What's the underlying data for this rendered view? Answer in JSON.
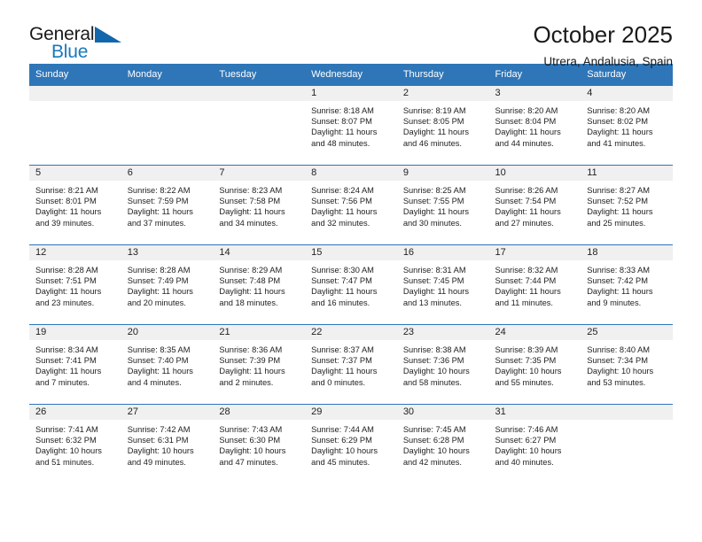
{
  "logo": {
    "general": "General",
    "blue": "Blue",
    "triangle_color": "#1166ac"
  },
  "header": {
    "title": "October 2025",
    "subtitle": "Utrera, Andalusia, Spain"
  },
  "theme": {
    "header_blue": "#2e76b8",
    "daynum_band": "#f0f0f0"
  },
  "weekday_headers": [
    "Sunday",
    "Monday",
    "Tuesday",
    "Wednesday",
    "Thursday",
    "Friday",
    "Saturday"
  ],
  "weeks": [
    [
      {
        "day": "",
        "sunrise": "",
        "sunset": "",
        "daylight_1": "",
        "daylight_2": "",
        "empty": true
      },
      {
        "day": "",
        "sunrise": "",
        "sunset": "",
        "daylight_1": "",
        "daylight_2": "",
        "empty": true
      },
      {
        "day": "",
        "sunrise": "",
        "sunset": "",
        "daylight_1": "",
        "daylight_2": "",
        "empty": true
      },
      {
        "day": "1",
        "sunrise": "Sunrise: 8:18 AM",
        "sunset": "Sunset: 8:07 PM",
        "daylight_1": "Daylight: 11 hours",
        "daylight_2": "and 48 minutes."
      },
      {
        "day": "2",
        "sunrise": "Sunrise: 8:19 AM",
        "sunset": "Sunset: 8:05 PM",
        "daylight_1": "Daylight: 11 hours",
        "daylight_2": "and 46 minutes."
      },
      {
        "day": "3",
        "sunrise": "Sunrise: 8:20 AM",
        "sunset": "Sunset: 8:04 PM",
        "daylight_1": "Daylight: 11 hours",
        "daylight_2": "and 44 minutes."
      },
      {
        "day": "4",
        "sunrise": "Sunrise: 8:20 AM",
        "sunset": "Sunset: 8:02 PM",
        "daylight_1": "Daylight: 11 hours",
        "daylight_2": "and 41 minutes."
      }
    ],
    [
      {
        "day": "5",
        "sunrise": "Sunrise: 8:21 AM",
        "sunset": "Sunset: 8:01 PM",
        "daylight_1": "Daylight: 11 hours",
        "daylight_2": "and 39 minutes."
      },
      {
        "day": "6",
        "sunrise": "Sunrise: 8:22 AM",
        "sunset": "Sunset: 7:59 PM",
        "daylight_1": "Daylight: 11 hours",
        "daylight_2": "and 37 minutes."
      },
      {
        "day": "7",
        "sunrise": "Sunrise: 8:23 AM",
        "sunset": "Sunset: 7:58 PM",
        "daylight_1": "Daylight: 11 hours",
        "daylight_2": "and 34 minutes."
      },
      {
        "day": "8",
        "sunrise": "Sunrise: 8:24 AM",
        "sunset": "Sunset: 7:56 PM",
        "daylight_1": "Daylight: 11 hours",
        "daylight_2": "and 32 minutes."
      },
      {
        "day": "9",
        "sunrise": "Sunrise: 8:25 AM",
        "sunset": "Sunset: 7:55 PM",
        "daylight_1": "Daylight: 11 hours",
        "daylight_2": "and 30 minutes."
      },
      {
        "day": "10",
        "sunrise": "Sunrise: 8:26 AM",
        "sunset": "Sunset: 7:54 PM",
        "daylight_1": "Daylight: 11 hours",
        "daylight_2": "and 27 minutes."
      },
      {
        "day": "11",
        "sunrise": "Sunrise: 8:27 AM",
        "sunset": "Sunset: 7:52 PM",
        "daylight_1": "Daylight: 11 hours",
        "daylight_2": "and 25 minutes."
      }
    ],
    [
      {
        "day": "12",
        "sunrise": "Sunrise: 8:28 AM",
        "sunset": "Sunset: 7:51 PM",
        "daylight_1": "Daylight: 11 hours",
        "daylight_2": "and 23 minutes."
      },
      {
        "day": "13",
        "sunrise": "Sunrise: 8:28 AM",
        "sunset": "Sunset: 7:49 PM",
        "daylight_1": "Daylight: 11 hours",
        "daylight_2": "and 20 minutes."
      },
      {
        "day": "14",
        "sunrise": "Sunrise: 8:29 AM",
        "sunset": "Sunset: 7:48 PM",
        "daylight_1": "Daylight: 11 hours",
        "daylight_2": "and 18 minutes."
      },
      {
        "day": "15",
        "sunrise": "Sunrise: 8:30 AM",
        "sunset": "Sunset: 7:47 PM",
        "daylight_1": "Daylight: 11 hours",
        "daylight_2": "and 16 minutes."
      },
      {
        "day": "16",
        "sunrise": "Sunrise: 8:31 AM",
        "sunset": "Sunset: 7:45 PM",
        "daylight_1": "Daylight: 11 hours",
        "daylight_2": "and 13 minutes."
      },
      {
        "day": "17",
        "sunrise": "Sunrise: 8:32 AM",
        "sunset": "Sunset: 7:44 PM",
        "daylight_1": "Daylight: 11 hours",
        "daylight_2": "and 11 minutes."
      },
      {
        "day": "18",
        "sunrise": "Sunrise: 8:33 AM",
        "sunset": "Sunset: 7:42 PM",
        "daylight_1": "Daylight: 11 hours",
        "daylight_2": "and 9 minutes."
      }
    ],
    [
      {
        "day": "19",
        "sunrise": "Sunrise: 8:34 AM",
        "sunset": "Sunset: 7:41 PM",
        "daylight_1": "Daylight: 11 hours",
        "daylight_2": "and 7 minutes."
      },
      {
        "day": "20",
        "sunrise": "Sunrise: 8:35 AM",
        "sunset": "Sunset: 7:40 PM",
        "daylight_1": "Daylight: 11 hours",
        "daylight_2": "and 4 minutes."
      },
      {
        "day": "21",
        "sunrise": "Sunrise: 8:36 AM",
        "sunset": "Sunset: 7:39 PM",
        "daylight_1": "Daylight: 11 hours",
        "daylight_2": "and 2 minutes."
      },
      {
        "day": "22",
        "sunrise": "Sunrise: 8:37 AM",
        "sunset": "Sunset: 7:37 PM",
        "daylight_1": "Daylight: 11 hours",
        "daylight_2": "and 0 minutes."
      },
      {
        "day": "23",
        "sunrise": "Sunrise: 8:38 AM",
        "sunset": "Sunset: 7:36 PM",
        "daylight_1": "Daylight: 10 hours",
        "daylight_2": "and 58 minutes."
      },
      {
        "day": "24",
        "sunrise": "Sunrise: 8:39 AM",
        "sunset": "Sunset: 7:35 PM",
        "daylight_1": "Daylight: 10 hours",
        "daylight_2": "and 55 minutes."
      },
      {
        "day": "25",
        "sunrise": "Sunrise: 8:40 AM",
        "sunset": "Sunset: 7:34 PM",
        "daylight_1": "Daylight: 10 hours",
        "daylight_2": "and 53 minutes."
      }
    ],
    [
      {
        "day": "26",
        "sunrise": "Sunrise: 7:41 AM",
        "sunset": "Sunset: 6:32 PM",
        "daylight_1": "Daylight: 10 hours",
        "daylight_2": "and 51 minutes."
      },
      {
        "day": "27",
        "sunrise": "Sunrise: 7:42 AM",
        "sunset": "Sunset: 6:31 PM",
        "daylight_1": "Daylight: 10 hours",
        "daylight_2": "and 49 minutes."
      },
      {
        "day": "28",
        "sunrise": "Sunrise: 7:43 AM",
        "sunset": "Sunset: 6:30 PM",
        "daylight_1": "Daylight: 10 hours",
        "daylight_2": "and 47 minutes."
      },
      {
        "day": "29",
        "sunrise": "Sunrise: 7:44 AM",
        "sunset": "Sunset: 6:29 PM",
        "daylight_1": "Daylight: 10 hours",
        "daylight_2": "and 45 minutes."
      },
      {
        "day": "30",
        "sunrise": "Sunrise: 7:45 AM",
        "sunset": "Sunset: 6:28 PM",
        "daylight_1": "Daylight: 10 hours",
        "daylight_2": "and 42 minutes."
      },
      {
        "day": "31",
        "sunrise": "Sunrise: 7:46 AM",
        "sunset": "Sunset: 6:27 PM",
        "daylight_1": "Daylight: 10 hours",
        "daylight_2": "and 40 minutes."
      },
      {
        "day": "",
        "sunrise": "",
        "sunset": "",
        "daylight_1": "",
        "daylight_2": "",
        "empty": true
      }
    ]
  ]
}
